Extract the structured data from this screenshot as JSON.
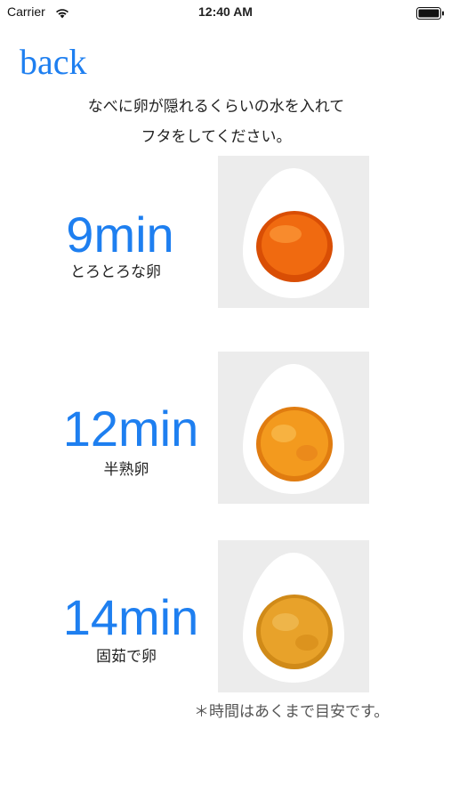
{
  "status_bar": {
    "carrier": "Carrier",
    "time": "12:40 AM"
  },
  "nav": {
    "back_label": "back"
  },
  "instructions": {
    "line1": "なべに卵が隠れるくらいの水を入れて",
    "line2": "フタをしてください。"
  },
  "eggs": [
    {
      "time": "9min",
      "label": "とろとろな卵",
      "yolk_color": "#f06a10"
    },
    {
      "time": "12min",
      "label": "半熟卵",
      "yolk_color": "#f39a1e"
    },
    {
      "time": "14min",
      "label": "固茹で卵",
      "yolk_color": "#e8a22a"
    }
  ],
  "footnote": "＊時間はあくまで目安です。",
  "colors": {
    "accent": "#1e7ff0",
    "tile_bg": "#ececec"
  }
}
